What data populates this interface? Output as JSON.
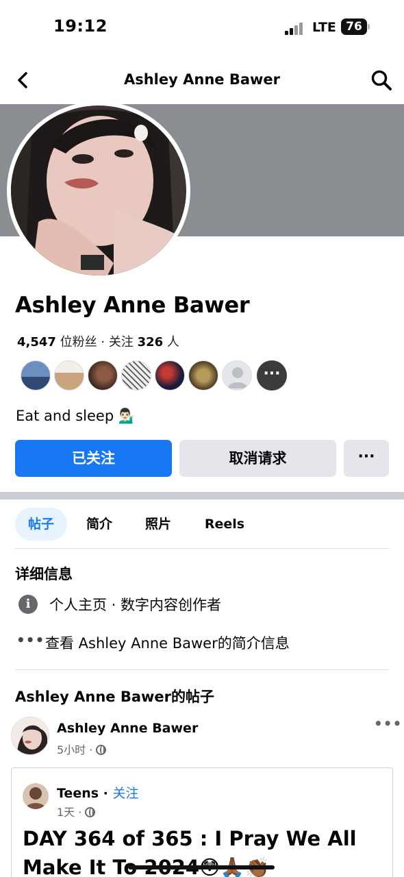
{
  "status_bar": {
    "time": "19:12",
    "network": "LTE",
    "battery": "76"
  },
  "nav": {
    "title": "Ashley Anne Bawer"
  },
  "profile": {
    "name": "Ashley Anne Bawer",
    "followers_count": "4,547",
    "followers_label": "位粉丝",
    "following_label": "关注",
    "following_count": "326",
    "following_unit": "人",
    "bio": "Eat and sleep 💁🏻‍♂️"
  },
  "actions": {
    "follow": "已关注",
    "cancel_request": "取消请求",
    "more": "···"
  },
  "tabs": [
    "帖子",
    "简介",
    "照片",
    "Reels"
  ],
  "details": {
    "title": "详细信息",
    "item1": "个人主页 · 数字内容创作者",
    "item2": "查看 Ashley Anne Bawer的简介信息"
  },
  "posts": {
    "title": "Ashley Anne Bawer的帖子",
    "author": "Ashley Anne Bawer",
    "time": "5小时 ·",
    "shared": {
      "author": "Teens",
      "separator": " · ",
      "follow": "关注",
      "time": "1天 ·",
      "text": "DAY 364 of 365 : I Pray We All Make It To 2024😳🙏🏾👏🏾"
    }
  },
  "colors": {
    "accent": "#1877f2",
    "cover": "#8a8d91",
    "button_gray": "#e4e6eb"
  }
}
